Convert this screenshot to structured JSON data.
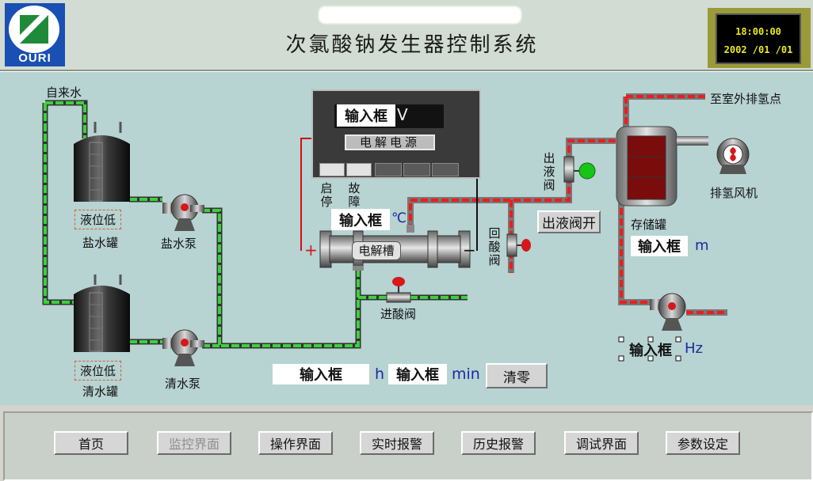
{
  "header": {
    "logo_text": "OURI",
    "title": "次氯酸钠发生器控制系统",
    "clock_time": "18:00:00",
    "clock_date": "2002 /01 /01"
  },
  "process": {
    "tap_water_label": "自来水",
    "brine_tank": {
      "level_warning": "液位低",
      "name": "盐水罐"
    },
    "clear_tank": {
      "level_warning": "液位低",
      "name": "清水罐"
    },
    "brine_pump": "盐水泵",
    "clear_pump": "清水泵",
    "power_supply": {
      "input_placeholder": "输入框",
      "unit": "V",
      "plate": "电解电源",
      "start_stop": "启停",
      "fault": "故障"
    },
    "electrolyzer": {
      "name": "电解槽",
      "temp_input": "输入框",
      "temp_unit": "℃",
      "plus": "+",
      "minus": "−"
    },
    "acid_inlet_valve": "进酸阀",
    "acid_return_valve": "回酸阀",
    "outlet_valve": "出液阀",
    "outlet_valve_button": "出液阀开",
    "storage_tank": {
      "name": "存储罐",
      "level_input": "输入框",
      "level_unit": "m"
    },
    "exhaust_destination": "至室外排氢点",
    "hydrogen_fan": "排氢风机",
    "pump_freq": {
      "input": "输入框",
      "unit": "Hz"
    },
    "runtime": {
      "hours_input": "输入框",
      "hours_unit": "h",
      "min_input": "输入框",
      "min_unit": "min",
      "reset_button": "清零"
    }
  },
  "nav": {
    "items": [
      {
        "label": "首页",
        "enabled": true
      },
      {
        "label": "监控界面",
        "enabled": false
      },
      {
        "label": "操作界面",
        "enabled": true
      },
      {
        "label": "实时报警",
        "enabled": true
      },
      {
        "label": "历史报警",
        "enabled": true
      },
      {
        "label": "调试界面",
        "enabled": true
      },
      {
        "label": "参数设定",
        "enabled": true
      }
    ]
  },
  "colors": {
    "panel_bg": "#b7d3d2",
    "water_pipe": "#3ecf3e",
    "product_pipe": "#ee1c1c",
    "clock_text": "#eaea20",
    "unit_text": "#1b2aa0"
  }
}
